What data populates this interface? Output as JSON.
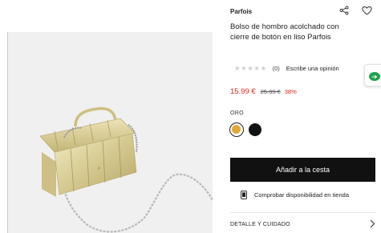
{
  "product": {
    "brand": "Parfois",
    "title": "Bolso de hombro acolchado con cierre de botón en liso Parfois",
    "rating": {
      "stars": "★★★★★",
      "count": "(0)",
      "review_link": "Escribe una opinión"
    },
    "price": {
      "current": "15.99 €",
      "original": "25.99 €",
      "discount": "38%"
    },
    "color": {
      "label": "ORO",
      "options": [
        "gold",
        "black"
      ],
      "swatch_colors": [
        "#e0a833",
        "#111111"
      ],
      "selected": "gold"
    },
    "add_to_cart_label": "Añadir a la cesta",
    "store_check_label": "Comprobar disponibilidad en tienda",
    "details_label": "DETALLE Y CUIDADO"
  },
  "icons": {
    "share": "share-icon",
    "favorite": "heart-icon",
    "chat": "chat-icon",
    "phone": "phone-icon",
    "chevron": "chevron-right-icon"
  },
  "colors": {
    "accent_red": "#e2231a",
    "button_black": "#111111",
    "chat_green": "#1fa24a"
  }
}
